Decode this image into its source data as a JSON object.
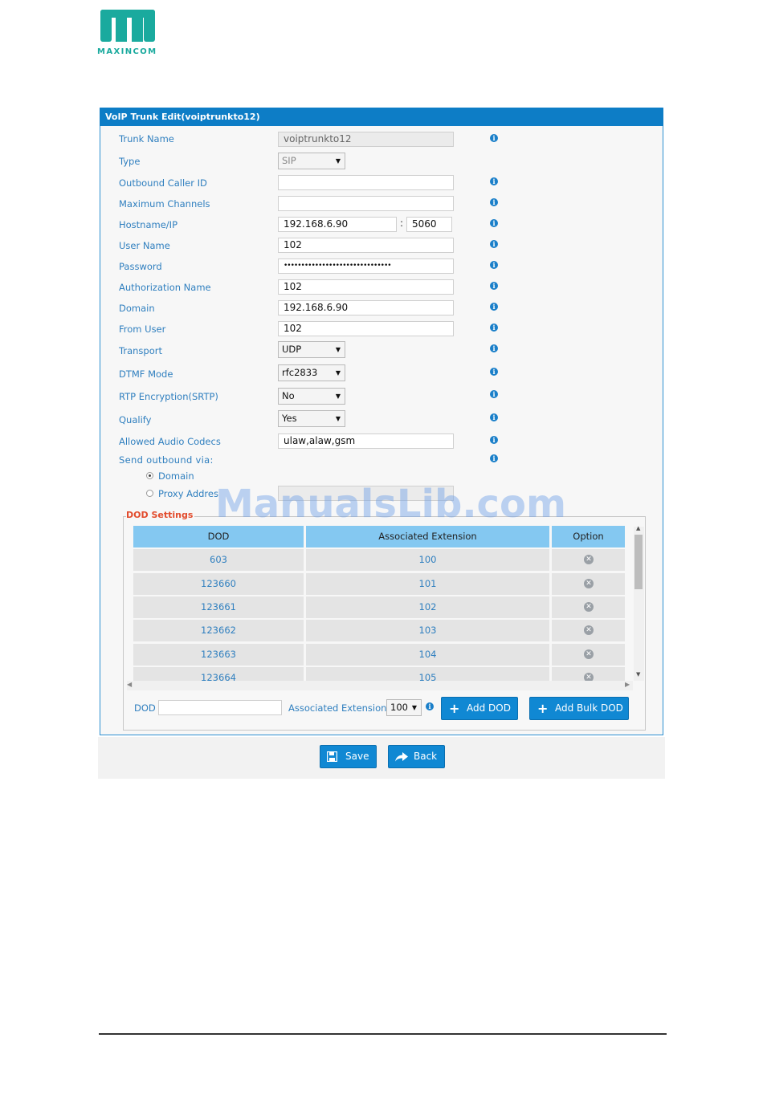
{
  "brand": {
    "logo_text": "MAXINCOM",
    "color": "#1aaa9e"
  },
  "panel": {
    "title": "VoIP Trunk Edit(voiptrunkto12)",
    "accent": "#0d7dc6"
  },
  "fields": {
    "trunk_name": {
      "label": "Trunk Name",
      "value": "voiptrunkto12"
    },
    "type": {
      "label": "Type",
      "value": "SIP"
    },
    "outbound_caller_id": {
      "label": "Outbound Caller ID",
      "value": ""
    },
    "max_channels": {
      "label": "Maximum Channels",
      "value": ""
    },
    "hostname": {
      "label": "Hostname/IP",
      "value": "192.168.6.90",
      "separator": ":",
      "port": "5060"
    },
    "user_name": {
      "label": "User Name",
      "value": "102"
    },
    "password": {
      "label": "Password",
      "value": "•••••••••••••••••••••••••••••••"
    },
    "auth_name": {
      "label": "Authorization Name",
      "value": "102"
    },
    "domain": {
      "label": "Domain",
      "value": "192.168.6.90"
    },
    "from_user": {
      "label": "From User",
      "value": "102"
    },
    "transport": {
      "label": "Transport",
      "value": "UDP"
    },
    "dtmf_mode": {
      "label": "DTMF Mode",
      "value": "rfc2833"
    },
    "rtp_encryption": {
      "label": "RTP Encryption(SRTP)",
      "value": "No"
    },
    "qualify": {
      "label": "Qualify",
      "value": "Yes"
    },
    "codecs": {
      "label": "Allowed Audio Codecs",
      "value": "ulaw,alaw,gsm"
    },
    "send_outbound": {
      "label": "Send outbound via:",
      "option_domain": "Domain",
      "option_proxy": "Proxy Addres",
      "proxy_value": ""
    }
  },
  "watermark": "ManualsLib.com",
  "dod": {
    "legend": "DOD Settings",
    "columns": [
      "DOD",
      "Associated Extension",
      "Option"
    ],
    "rows": [
      {
        "dod": "603",
        "ext": "100"
      },
      {
        "dod": "123660",
        "ext": "101"
      },
      {
        "dod": "123661",
        "ext": "102"
      },
      {
        "dod": "123662",
        "ext": "103"
      },
      {
        "dod": "123663",
        "ext": "104"
      },
      {
        "dod": "123664",
        "ext": "105"
      }
    ],
    "add_dod_label": "DOD",
    "add_dod_value": "",
    "assoc_ext_label": "Associated Extension",
    "assoc_ext_value": "100",
    "add_dod_button": "Add DOD",
    "add_bulk_button": "Add Bulk DOD"
  },
  "actions": {
    "save": "Save",
    "back": "Back"
  }
}
